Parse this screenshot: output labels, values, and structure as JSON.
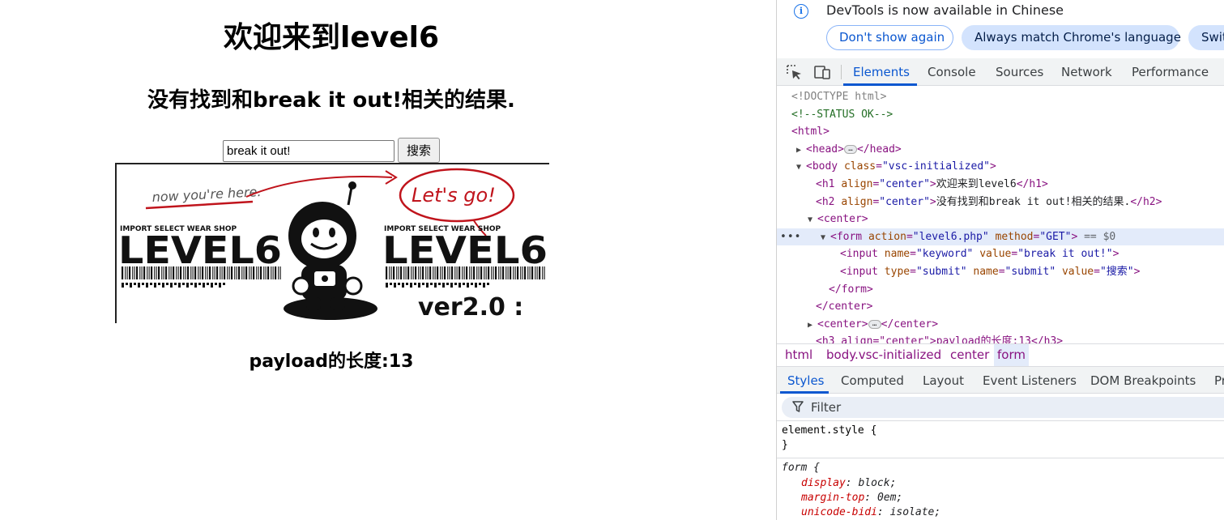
{
  "page": {
    "h1": "欢迎来到level6",
    "h2": "没有找到和break it out!相关的结果.",
    "search": {
      "value": "break it out!",
      "submit_label": "搜索"
    },
    "banner": {
      "handwritten_left": "now you're here.",
      "handwritten_right": "Let's go!",
      "shop_label_left": "IMPORT SELECT WEAR SHOP",
      "shop_label_right": "IMPORT SELECT WEAR SHOP",
      "brand_left": "LEVEL6",
      "brand_right": "LEVEL6",
      "version": "ver2.0 :"
    },
    "payload": "payload的长度:13"
  },
  "devtools": {
    "infobar": {
      "message": "DevTools is now available in Chinese",
      "dont_show": "Don't show again",
      "always_match": "Always match Chrome's language",
      "switch": "Swit"
    },
    "tabs": [
      "Elements",
      "Console",
      "Sources",
      "Network",
      "Performance"
    ],
    "active_tab": "Elements",
    "dom_lines": {
      "doctype": "<!DOCTYPE html>",
      "comment": "<!--STATUS OK-->",
      "html_open": "<html>",
      "head_open": "<head>",
      "head_close": "</head>",
      "body_tag": "body",
      "body_class_attr": "class",
      "body_class_val": "\"vsc-initialized\"",
      "h1_tag": "h1",
      "align_attr": "align",
      "center_val": "\"center\"",
      "h1_text": "欢迎来到level6",
      "h1_close": "</h1>",
      "h2_tag": "h2",
      "h2_text": "没有找到和break it out!相关的结果.",
      "h2_close": "</h2>",
      "center_open": "<center>",
      "form_tag": "form",
      "action_attr": "action",
      "action_val": "\"level6.php\"",
      "method_attr": "method",
      "method_val": "\"GET\"",
      "eq_marker": "== $0",
      "input_tag": "input",
      "name_attr": "name",
      "keyword_val": "\"keyword\"",
      "value_attr": "value",
      "break_val": "\"break it out!\"",
      "type_attr": "type",
      "submit_type_val": "\"submit\"",
      "submit_name_val": "\"submit\"",
      "submit_value_val": "\"搜索\"",
      "form_close": "</form>",
      "center_close": "</center>",
      "h3_partial": "<h3 align=\"center\">payload的长度:13</h3>",
      "ellipsis": "…",
      "row_menu": "•••"
    },
    "breadcrumbs": [
      "html",
      "body.vsc-initialized",
      "center",
      "form"
    ],
    "styles_tabs": [
      "Styles",
      "Computed",
      "Layout",
      "Event Listeners",
      "DOM Breakpoints",
      "Pr"
    ],
    "filter_placeholder": "Filter",
    "styles": {
      "element_style_open": "element.style {",
      "close_brace": "}",
      "form_selector": "form {",
      "props": [
        {
          "name": "display",
          "value": "block;"
        },
        {
          "name": "margin-top",
          "value": "0em;"
        },
        {
          "name": "unicode-bidi",
          "value": "isolate;"
        }
      ]
    }
  }
}
